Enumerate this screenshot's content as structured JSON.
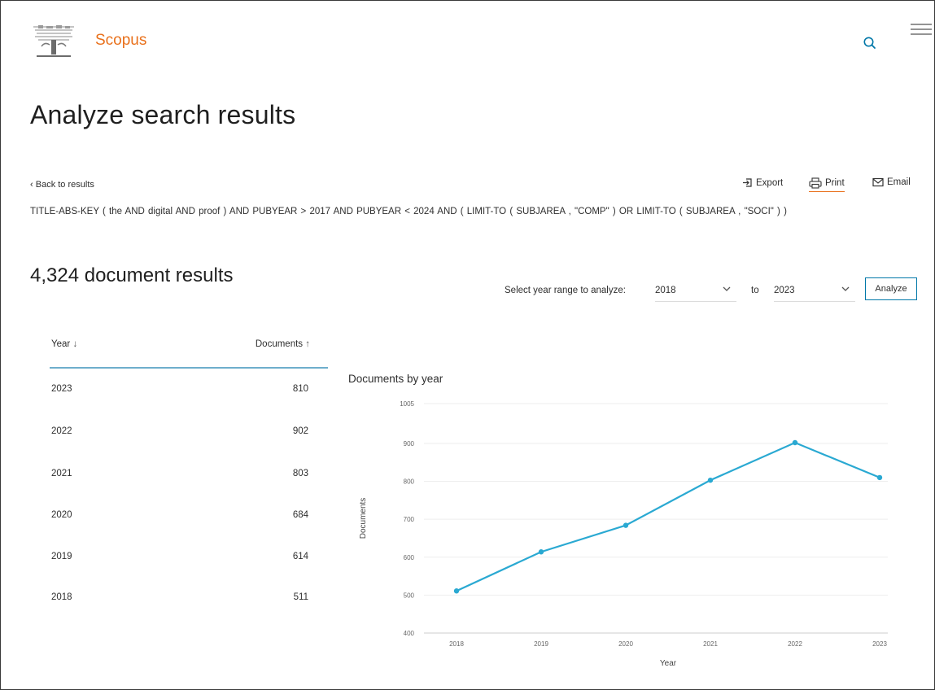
{
  "header": {
    "brand": "Scopus",
    "logo_icon": "elsevier-tree-logo",
    "search_icon": "search-icon",
    "menu_icon": "hamburger-menu-icon"
  },
  "page": {
    "title": "Analyze search results"
  },
  "toolbar": {
    "back_label": "Back to results",
    "export_label": "Export",
    "print_label": "Print",
    "email_label": "Email"
  },
  "query": "TITLE-ABS-KEY ( the AND digital AND proof ) AND PUBYEAR > 2017 AND PUBYEAR < 2024 AND ( LIMIT-TO ( SUBJAREA , \"COMP\" ) OR LIMIT-TO ( SUBJAREA , \"SOCI\" ) )",
  "results": {
    "count_label": "4,324 document results"
  },
  "range": {
    "label": "Select year range to analyze:",
    "from": "2018",
    "to_label": "to",
    "to": "2023",
    "analyze_label": "Analyze"
  },
  "table": {
    "year_header": "Year",
    "docs_header": "Documents",
    "rows": [
      {
        "year": "2023",
        "count": "810"
      },
      {
        "year": "2022",
        "count": "902"
      },
      {
        "year": "2021",
        "count": "803"
      },
      {
        "year": "2020",
        "count": "684"
      },
      {
        "year": "2019",
        "count": "614"
      },
      {
        "year": "2018",
        "count": "511"
      }
    ]
  },
  "colors": {
    "accent": "#e9711c",
    "line": "#2aa9d2",
    "button_border": "#0077a8",
    "table_rule": "#6eaecc"
  },
  "chart_data": {
    "type": "line",
    "title": "Documents by year",
    "xlabel": "Year",
    "ylabel": "Documents",
    "categories": [
      "2018",
      "2019",
      "2020",
      "2021",
      "2022",
      "2023"
    ],
    "series": [
      {
        "values": [
          511,
          614,
          684,
          803,
          902,
          810
        ]
      }
    ],
    "ylim": [
      400,
      1005
    ],
    "yticks": [
      "400",
      "500",
      "600",
      "700",
      "800",
      "900",
      "1005"
    ],
    "grid": true,
    "legend": "none"
  }
}
